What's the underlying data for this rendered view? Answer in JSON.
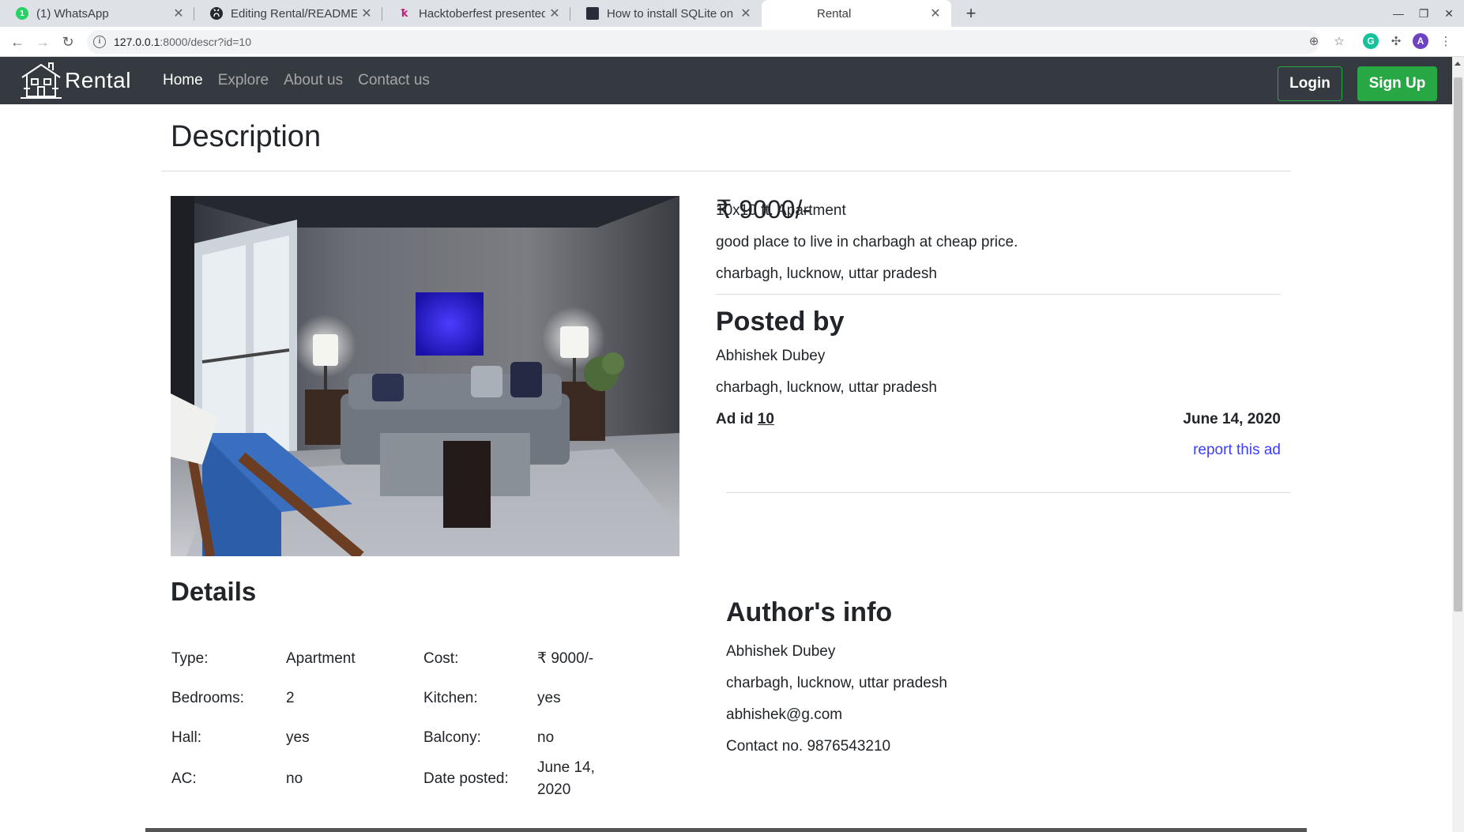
{
  "browser": {
    "tabs": [
      {
        "title": "(1) WhatsApp",
        "icon": "whatsapp-icon"
      },
      {
        "title": "Editing Rental/README.m",
        "icon": "github-icon"
      },
      {
        "title": "Hacktoberfest presented",
        "icon": "hacktoberfest-icon"
      },
      {
        "title": "How to install SQLite on U",
        "icon": "page-icon"
      },
      {
        "title": "Rental",
        "icon": "none"
      }
    ],
    "whatsapp_badge": "1",
    "url_host": "127.0.0.1",
    "url_rest": ":8000/descr?id=10",
    "profile_initial": "A"
  },
  "site": {
    "brand": "Rental",
    "nav": {
      "home": "Home",
      "explore": "Explore",
      "about": "About us",
      "contact": "Contact us"
    },
    "login": "Login",
    "signup": "Sign Up",
    "colors": {
      "navbar": "#343a40",
      "accent": "#28a745",
      "link": "#3d3dff"
    }
  },
  "listing": {
    "page_title": "Description",
    "price": "₹ 9000/-",
    "size_type": "10x10 ft. Apartment",
    "description": "good place to live in charbagh at cheap price.",
    "address": "charbagh, lucknow, uttar pradesh",
    "posted_by_heading": "Posted by",
    "poster_name": "Abhishek Dubey",
    "poster_address": "charbagh, lucknow, uttar pradesh",
    "ad_id_label": "Ad id",
    "ad_id": "10",
    "date": "June 14, 2020",
    "report": "report this ad"
  },
  "details": {
    "heading": "Details",
    "rows": [
      {
        "label1": "Type:",
        "value1": "Apartment",
        "label2": "Cost:",
        "value2": "₹ 9000/-"
      },
      {
        "label1": "Bedrooms:",
        "value1": "2",
        "label2": "Kitchen:",
        "value2": "yes"
      },
      {
        "label1": "Hall:",
        "value1": "yes",
        "label2": "Balcony:",
        "value2": "no"
      },
      {
        "label1": "AC:",
        "value1": "no",
        "label2": "Date posted:",
        "value2": "June 14, 2020"
      }
    ]
  },
  "author": {
    "heading": "Author's info",
    "name": "Abhishek Dubey",
    "address": "charbagh, lucknow, uttar pradesh",
    "email": "abhishek@g.com",
    "contact": "Contact no. 9876543210"
  }
}
